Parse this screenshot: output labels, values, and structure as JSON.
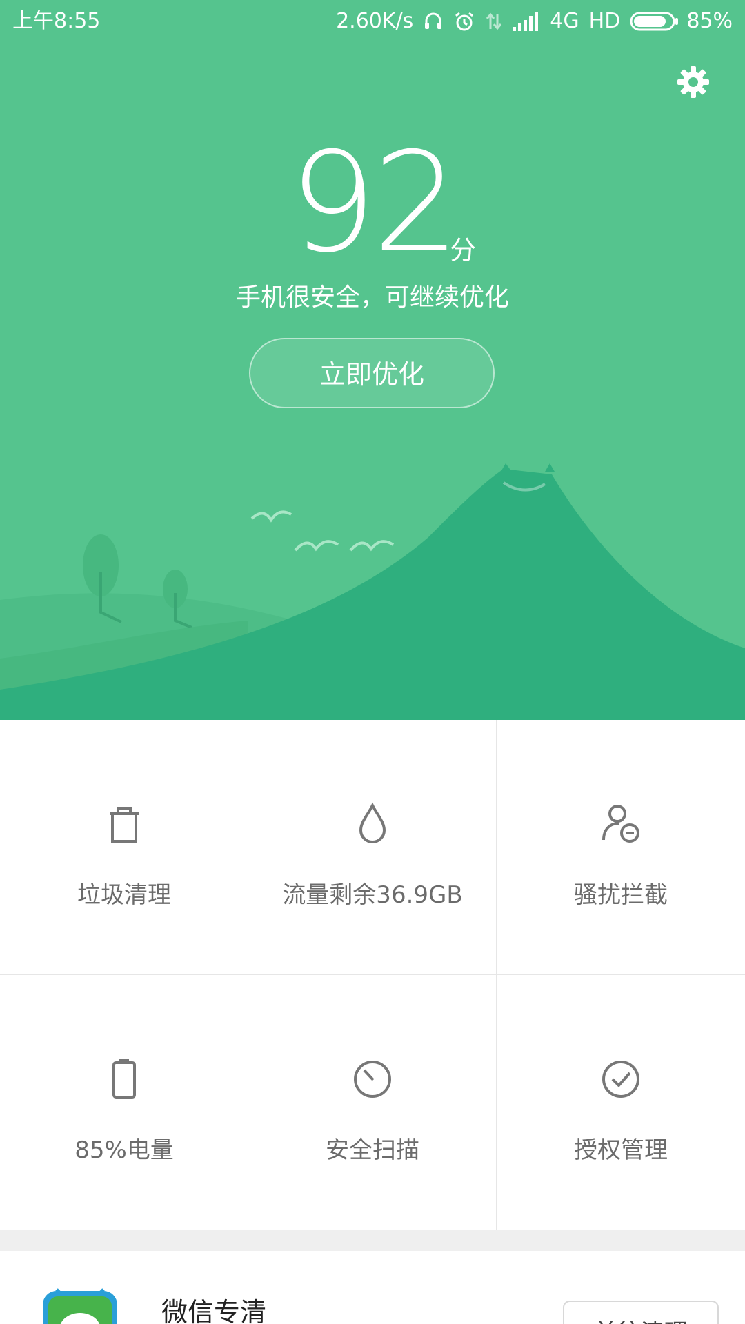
{
  "status_bar": {
    "time": "上午8:55",
    "net_speed": "2.60K/s",
    "network": "4G",
    "hd": "HD",
    "battery_pct": "85%",
    "battery_level": 0.85,
    "icons": [
      "headset-icon",
      "alarm-icon",
      "data-arrows-icon",
      "signal-icon",
      "battery-icon"
    ]
  },
  "hero": {
    "background_color": "#55c48e",
    "score": "92",
    "score_unit": "分",
    "status_message": "手机很安全，可继续优化",
    "optimize_button": "立即优化",
    "settings_icon": "gear-icon"
  },
  "tiles": [
    {
      "label": "垃圾清理",
      "icon": "trash-icon"
    },
    {
      "label": "流量剩余36.9GB",
      "icon": "drop-icon"
    },
    {
      "label": "骚扰拦截",
      "icon": "user-block-icon"
    },
    {
      "label": "85%电量",
      "icon": "battery-icon"
    },
    {
      "label": "安全扫描",
      "icon": "scan-icon"
    },
    {
      "label": "授权管理",
      "icon": "check-circle-icon"
    }
  ],
  "card": {
    "title": "微信专清",
    "button": "前往清理",
    "icon": "wechat-icon"
  }
}
